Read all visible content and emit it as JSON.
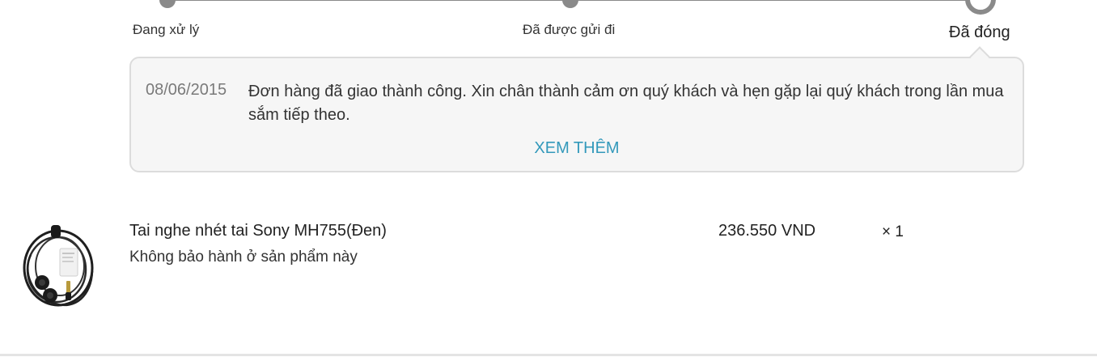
{
  "tracker": {
    "steps": [
      {
        "label": "Đang xử lý"
      },
      {
        "label": "Đã được gửi đi"
      },
      {
        "label": "Đã đóng"
      }
    ],
    "current_step": 3
  },
  "note": {
    "date": "08/06/2015",
    "message": "Đơn hàng đã giao thành công. Xin chân thành cảm ơn quý khách và hẹn gặp lại quý khách trong lần mua sắm tiếp theo.",
    "more_label": "XEM THÊM"
  },
  "product": {
    "image_icon": "earphones-image",
    "name": "Tai nghe nhét tai Sony MH755(Đen)",
    "warranty": "Không bảo hành ở sản phẩm này",
    "price": "236.550 VND",
    "quantity": "× 1"
  },
  "colors": {
    "accent_link": "#3399bb",
    "tracker": "#8a8a8a",
    "note_background": "#f6f6f6"
  }
}
